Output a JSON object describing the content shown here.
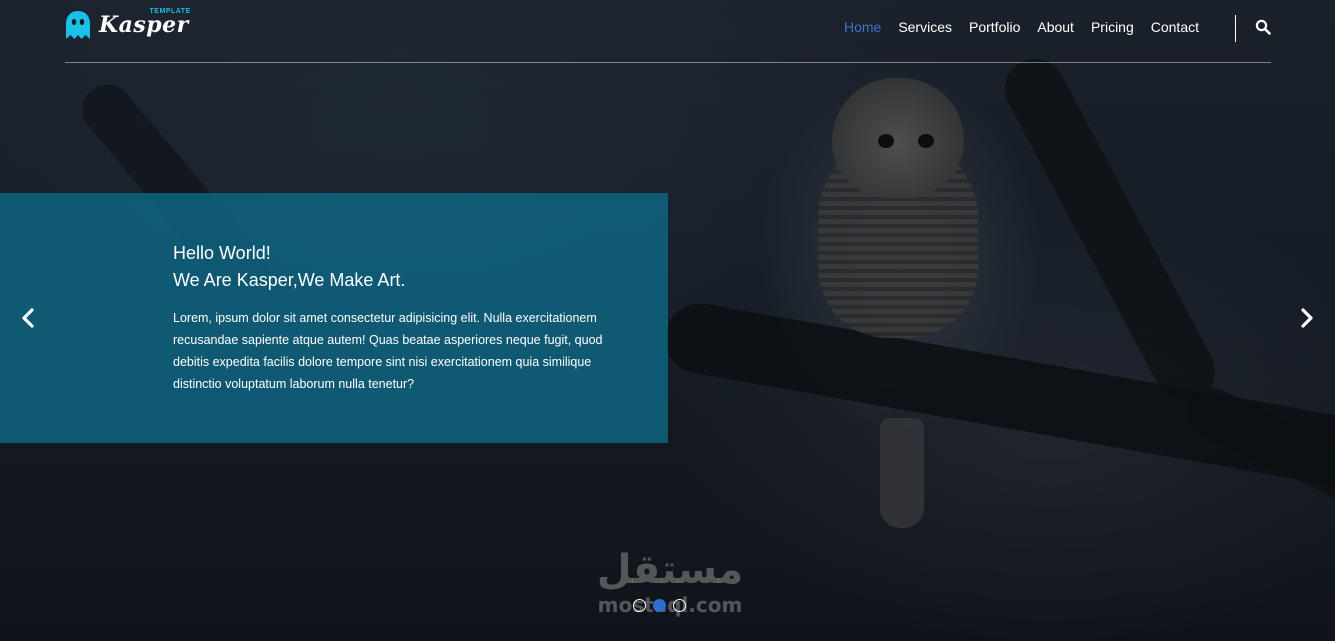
{
  "brand": {
    "name": "Kasper",
    "tag": "TEMPLATE",
    "accent": "#19c0ea",
    "icon": "ghost-icon"
  },
  "nav": {
    "items": [
      {
        "label": "Home",
        "active": true
      },
      {
        "label": "Services",
        "active": false
      },
      {
        "label": "Portfolio",
        "active": false
      },
      {
        "label": "About",
        "active": false
      },
      {
        "label": "Pricing",
        "active": false
      },
      {
        "label": "Contact",
        "active": false
      }
    ],
    "active_color": "#3f74c9",
    "search_icon": "search-icon"
  },
  "slide": {
    "heading_line1": "Hello World!",
    "heading_line2": "We Are Kasper,We Make Art.",
    "body": "Lorem, ipsum dolor sit amet consectetur adipisicing elit. Nulla exercitationem recusandae sapiente atque autem! Quas beatae asperiores neque fugit, quod debitis expedita facilis dolore tempore sint nisi exercitationem quia similique distinctio voluptatum laborum nulla tenetur?",
    "panel_color": "#0e6380"
  },
  "controls": {
    "prev_icon": "chevron-left-icon",
    "next_icon": "chevron-right-icon",
    "bullets": 3,
    "active_bullet": 1
  },
  "watermark": {
    "arabic": "مستقل",
    "latin": "mostaql.com"
  }
}
